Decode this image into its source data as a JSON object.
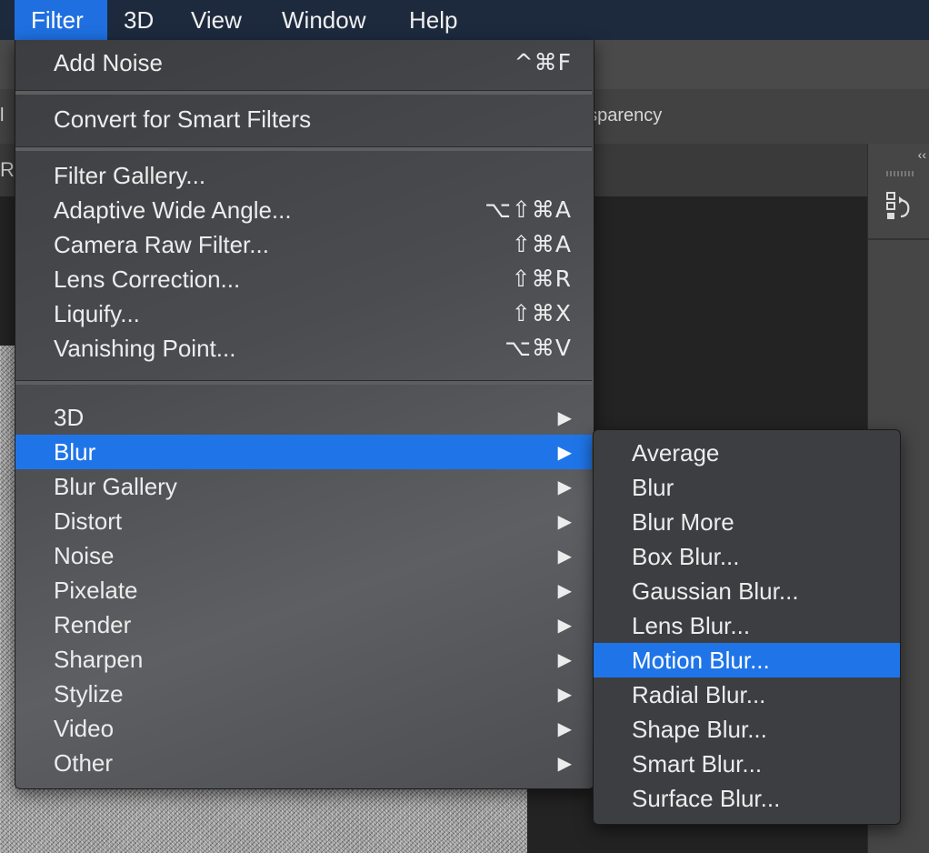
{
  "menubar": {
    "items": [
      "Filter",
      "3D",
      "View",
      "Window",
      "Help"
    ]
  },
  "background": {
    "options_partial_text": "nsparency",
    "options_left_fragment": "l",
    "tab_left_fragment": "RC",
    "panel_collapse": "‹‹",
    "history_icon": "history-icon"
  },
  "filter_menu": {
    "last_filter": {
      "label": "Add Noise",
      "shortcut": "^⌘F"
    },
    "convert": {
      "label": "Convert for Smart Filters"
    },
    "group1": [
      {
        "label": "Filter Gallery...",
        "shortcut": ""
      },
      {
        "label": "Adaptive Wide Angle...",
        "shortcut": "⌥⇧⌘A"
      },
      {
        "label": "Camera Raw Filter...",
        "shortcut": "⇧⌘A"
      },
      {
        "label": "Lens Correction...",
        "shortcut": "⇧⌘R"
      },
      {
        "label": "Liquify...",
        "shortcut": "⇧⌘X"
      },
      {
        "label": "Vanishing Point...",
        "shortcut": "⌥⌘V"
      }
    ],
    "submenus": [
      {
        "label": "3D"
      },
      {
        "label": "Blur"
      },
      {
        "label": "Blur Gallery"
      },
      {
        "label": "Distort"
      },
      {
        "label": "Noise"
      },
      {
        "label": "Pixelate"
      },
      {
        "label": "Render"
      },
      {
        "label": "Sharpen"
      },
      {
        "label": "Stylize"
      },
      {
        "label": "Video"
      },
      {
        "label": "Other"
      }
    ],
    "submenu_arrow": "▶",
    "highlighted_submenu": "Blur"
  },
  "blur_submenu": {
    "items": [
      "Average",
      "Blur",
      "Blur More",
      "Box Blur...",
      "Gaussian Blur...",
      "Lens Blur...",
      "Motion Blur...",
      "Radial Blur...",
      "Shape Blur...",
      "Smart Blur...",
      "Surface Blur..."
    ],
    "highlighted": "Motion Blur..."
  },
  "colors": {
    "highlight": "#1f75e8",
    "menubar_active": "#1f6fe0"
  }
}
